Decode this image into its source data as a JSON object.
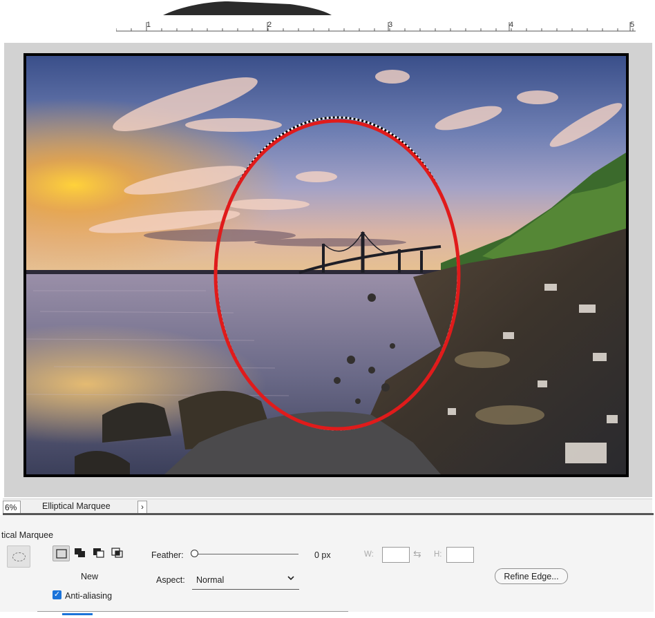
{
  "ruler": {
    "ticks": [
      "1",
      "2",
      "3",
      "4",
      "5"
    ]
  },
  "status_bar": {
    "zoom": "6%",
    "tool_name": "Elliptical Marquee",
    "arrow": "›"
  },
  "options": {
    "panel_title": "tical Marquee",
    "selection_mode": "New",
    "anti_aliasing_label": "Anti-aliasing",
    "anti_aliasing_checked": true,
    "feather_label": "Feather:",
    "feather_value": "0 px",
    "width_label": "W:",
    "height_label": "H:",
    "width_value": "",
    "height_value": "",
    "aspect_label": "Aspect:",
    "aspect_value": "Normal",
    "refine_edge_label": "Refine Edge..."
  },
  "colors": {
    "selection_outline": "#e01b1b",
    "checkbox_accent": "#1a73d9"
  },
  "icons": [
    "ellipse-preset-icon",
    "new-selection-icon",
    "add-selection-icon",
    "subtract-selection-icon",
    "intersect-selection-icon",
    "swap-icon",
    "chevron-down-icon",
    "check-icon"
  ]
}
